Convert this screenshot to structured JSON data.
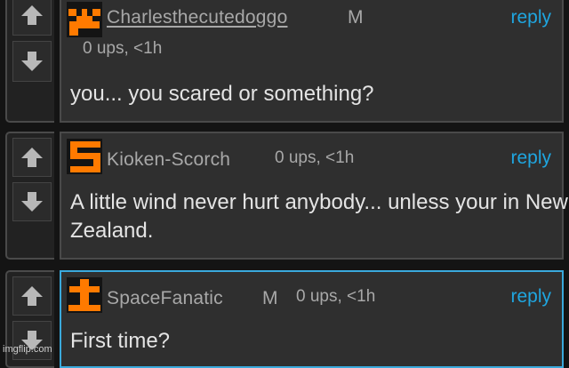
{
  "comments": [
    {
      "username": "Charlesthecutedoggo",
      "badge": "M",
      "meta": "0 ups, <1h",
      "reply_label": "reply",
      "text": "you... you scared or something?"
    },
    {
      "username": "Kioken-Scorch",
      "badge": "",
      "meta": "0 ups, <1h",
      "reply_label": "reply",
      "text": "A little wind never hurt anybody... unless your in New Zealand."
    },
    {
      "username": "SpaceFanatic",
      "badge": "M",
      "meta": "0 ups, <1h",
      "reply_label": "reply",
      "text": "First time?"
    }
  ],
  "watermark": "imgflip.com",
  "colors": {
    "background": "#141414",
    "panel": "#2f2f2f",
    "border": "#4a4a4a",
    "reply": "#1fa6e0",
    "avatar": "#ff7a00",
    "highlight_border": "#3aa9dc"
  },
  "icons": [
    "upvote-arrow-icon",
    "downvote-arrow-icon"
  ]
}
